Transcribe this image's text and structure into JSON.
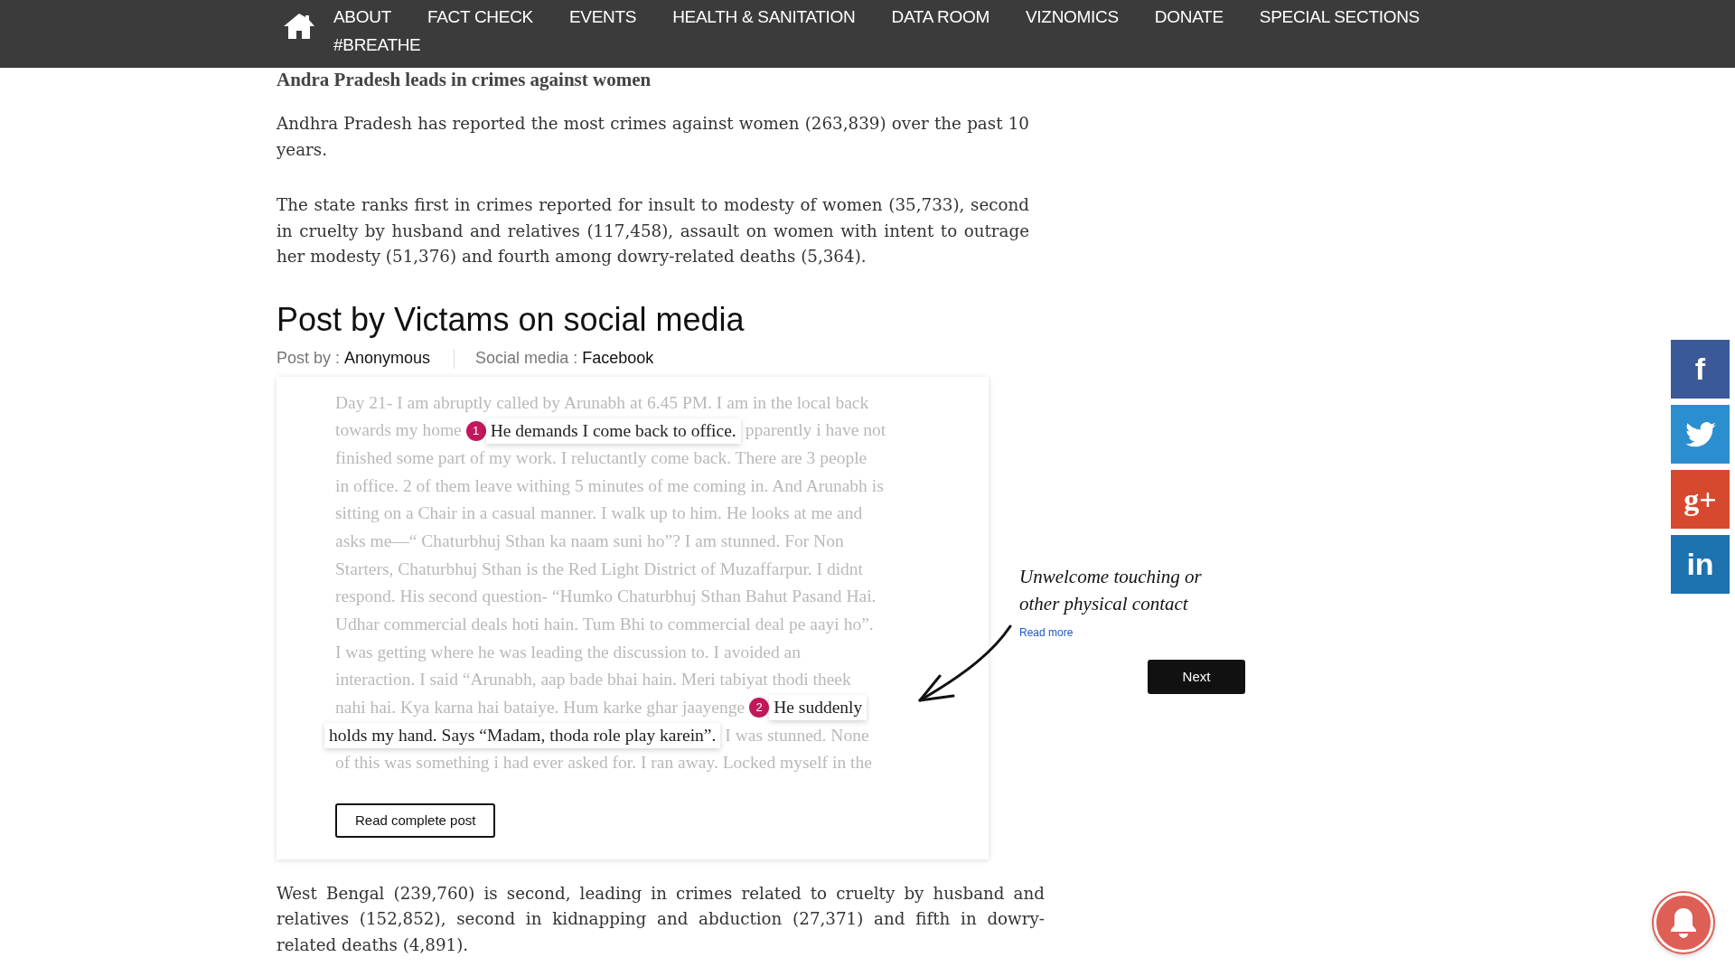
{
  "nav": {
    "items": [
      {
        "label": "ABOUT"
      },
      {
        "label": "FACT CHECK"
      },
      {
        "label": "EVENTS"
      },
      {
        "label": "HEALTH & SANITATION"
      },
      {
        "label": "DATA ROOM"
      },
      {
        "label": "VIZNOMICS"
      },
      {
        "label": "DONATE"
      },
      {
        "label": "SPECIAL SECTIONS"
      },
      {
        "label": "#BREATHE"
      }
    ]
  },
  "article": {
    "heading": "Andra Pradesh leads in crimes against women",
    "paragraphs": [
      "Andhra Pradesh has reported the most crimes against women (263,839) over the past 10 years.",
      "The state ranks first in crimes reported for insult to modesty of women (35,733), second in cruelty by husband and relatives (117,458), assault on women with intent to outrage her modesty (51,376) and fourth among dowry-related deaths (5,364)."
    ],
    "post_title": "Post by Victams on social media",
    "meta": [
      {
        "label": "Post by :",
        "value": "Anonymous"
      },
      {
        "label": "Social media :",
        "value": "Facebook"
      }
    ],
    "post": {
      "lines": [
        {
          "segments": [
            {
              "kind": "faded",
              "text": "Day 21- I am abruptly called by Arunabh at 6.45 PM. I am in the local back"
            }
          ]
        },
        {
          "segments": [
            {
              "kind": "faded",
              "text": "towards my home"
            },
            {
              "kind": "highlight",
              "number": "1",
              "text": "He demands I come back to office."
            },
            {
              "kind": "faded",
              "text": "pparently i have not"
            }
          ]
        },
        {
          "segments": [
            {
              "kind": "faded",
              "text": "finished some part of my work. I reluctantly come back. There are 3 people"
            }
          ]
        },
        {
          "segments": [
            {
              "kind": "faded",
              "text": "in office. 2 of them leave withing 5 minutes of me coming in. And Arunabh is"
            }
          ]
        },
        {
          "segments": [
            {
              "kind": "faded",
              "text": "sitting on a Chair in a casual manner. I walk up to him. He looks at me and"
            }
          ]
        },
        {
          "segments": [
            {
              "kind": "faded",
              "text": "asks me—“ Chaturbhuj Sthan ka naam suni ho”? I am stunned. For Non"
            }
          ]
        },
        {
          "segments": [
            {
              "kind": "faded",
              "text": "Starters, Chaturbhuj Sthan is the Red Light District of Muzaffarpur. I didnt"
            }
          ]
        },
        {
          "segments": [
            {
              "kind": "faded",
              "text": "respond. His second question- “Humko Chaturbhuj Sthan Bahut Pasand Hai."
            }
          ]
        },
        {
          "segments": [
            {
              "kind": "faded",
              "text": "Udhar commercial deals hoti hain. Tum Bhi to commercial deal pe aayi ho”."
            }
          ]
        },
        {
          "segments": [
            {
              "kind": "faded",
              "text": "I was getting where he was leading the discussion to. I avoided an"
            }
          ]
        },
        {
          "segments": [
            {
              "kind": "faded",
              "text": "interaction. I said “Arunabh, aap bade bhai hain. Meri tabiyat thodi theek"
            }
          ]
        },
        {
          "segments": [
            {
              "kind": "faded",
              "text": "nahi hai. Kya karna hai bataiye. Hum karke ghar jaayenge"
            },
            {
              "kind": "highlight",
              "number": "2",
              "text": "He suddenly"
            }
          ]
        },
        {
          "segments": [
            {
              "kind": "highlight",
              "text": "holds my hand. Says “Madam, thoda role play karein”."
            },
            {
              "kind": "faded",
              "text": "I was stunned. None"
            }
          ]
        },
        {
          "segments": [
            {
              "kind": "faded",
              "text": "of this was something i had ever asked for. I ran away. Locked myself in the"
            }
          ]
        }
      ],
      "button": "Read complete post"
    },
    "aside": {
      "note": "Unwelcome touching or other physical contact",
      "link": "Read more",
      "next": "Next"
    },
    "closing": "West Bengal (239,760) is second, leading in crimes related to cruelty by husband and relatives (152,852), second in kidnapping and abduction (27,371) and fifth in dowry-related deaths (4,891)."
  },
  "share": [
    {
      "kind": "facebook",
      "label": "f",
      "color": "#3b5998"
    },
    {
      "kind": "twitter",
      "color": "#2b8fcf"
    },
    {
      "kind": "google",
      "label": "g+",
      "color": "#d6492f"
    },
    {
      "kind": "linkedin",
      "label": "in",
      "color": "#1d72b0"
    }
  ]
}
